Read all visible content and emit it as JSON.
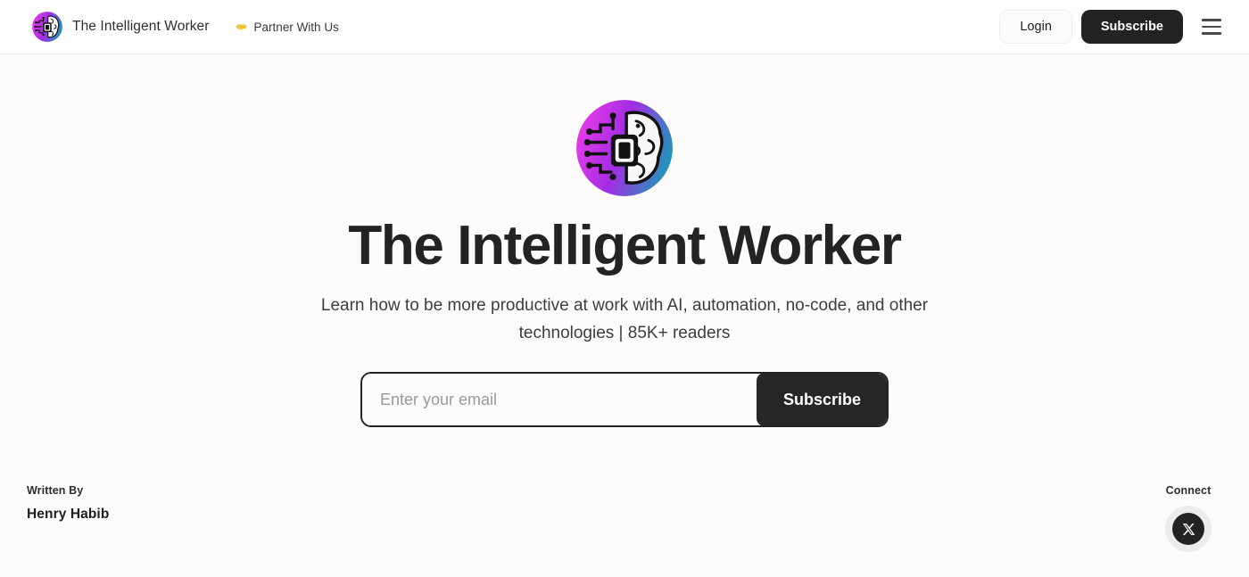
{
  "header": {
    "brand_name": "The Intelligent Worker",
    "brand_logo_icon": "brain-circuit-logo-icon",
    "partner_label": "Partner With Us",
    "partner_icon": "handshake-icon",
    "login_label": "Login",
    "subscribe_label": "Subscribe",
    "menu_icon": "hamburger-menu-icon"
  },
  "hero": {
    "logo_icon": "brain-circuit-logo-icon",
    "title": "The Intelligent Worker",
    "subtitle": "Learn how to be more productive at work with AI, automation, no-code, and other technologies | 85K+ readers",
    "email_placeholder": "Enter your email",
    "email_value": "",
    "subscribe_label": "Subscribe"
  },
  "footer": {
    "written_by_label": "Written By",
    "author_name": "Henry Habib",
    "connect_label": "Connect",
    "socials": [
      {
        "name": "x-twitter-icon",
        "glyph": "X"
      }
    ]
  },
  "colors": {
    "page_background": "#fdfcfa",
    "header_background": "#ffffff",
    "dark": "#232323",
    "text": "#2e2e2e",
    "muted": "#9a9a9a",
    "logo_gradient_start": "#e040e8",
    "logo_gradient_mid": "#9b30e0",
    "logo_gradient_end": "#1d9db5",
    "social_chip_background": "#eeecea"
  }
}
